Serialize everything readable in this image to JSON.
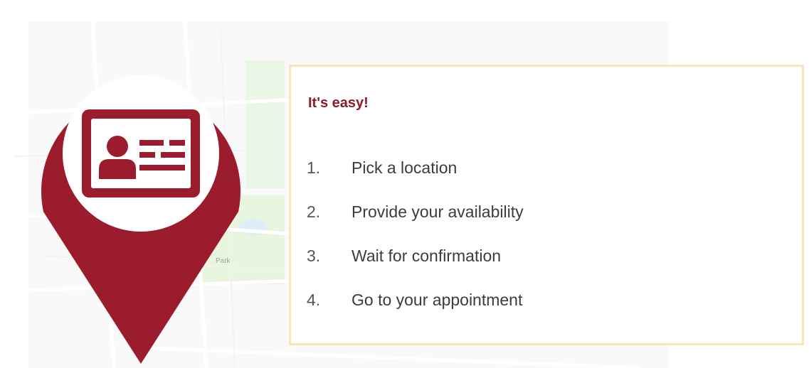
{
  "theme": {
    "brand_color": "#9b1c2c",
    "card_border_color": "#f4e7b8"
  },
  "pin": {
    "icon": "id-card-icon"
  },
  "card": {
    "title": "It's easy!",
    "steps": [
      {
        "number": "1.",
        "label": "Pick a location"
      },
      {
        "number": "2.",
        "label": "Provide your availability"
      },
      {
        "number": "3.",
        "label": "Wait for confirmation"
      },
      {
        "number": "4.",
        "label": "Go to your appointment"
      }
    ]
  },
  "map": {
    "labels": [
      "Park"
    ]
  }
}
